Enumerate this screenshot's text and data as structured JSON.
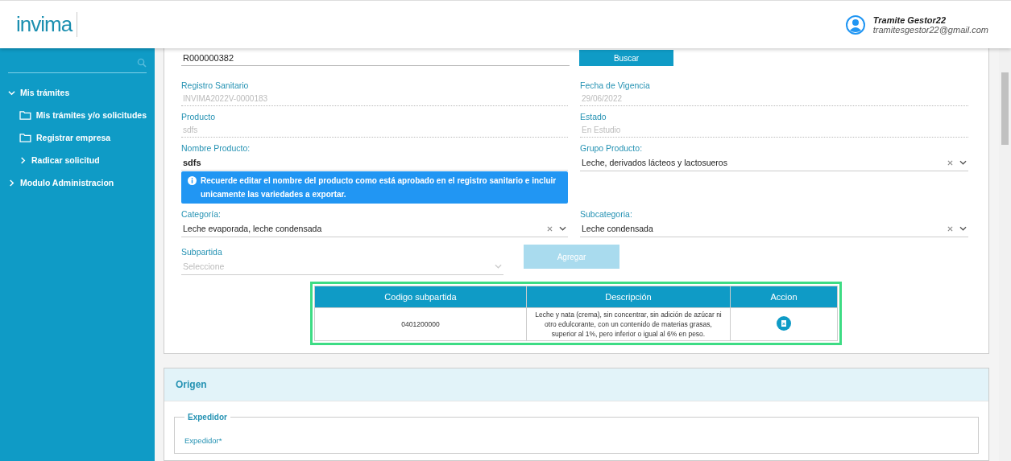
{
  "header": {
    "logo": "invima",
    "user": {
      "name": "Tramite Gestor22",
      "email": "tramitesgestor22@gmail.com"
    }
  },
  "sidebar": {
    "items": [
      {
        "label": "Mis trámites",
        "kind": "group",
        "expanded": true,
        "children": [
          {
            "label": "Mis trámites y/o solicitudes",
            "kind": "folder"
          },
          {
            "label": "Registrar empresa",
            "kind": "folder"
          },
          {
            "label": "Radicar solicitud",
            "kind": "group",
            "expanded": false
          }
        ]
      },
      {
        "label": "Modulo Administracion",
        "kind": "group",
        "expanded": false
      }
    ]
  },
  "search": {
    "value": "R000000382",
    "button": "Buscar"
  },
  "fields": [
    {
      "label": "Registro Sanitario",
      "value": "INVIMA2022V-0000183",
      "kind": "readonly"
    },
    {
      "label": "Fecha de Vigencia",
      "value": "29/06/2022",
      "kind": "readonly"
    },
    {
      "label": "Producto",
      "value": "sdfs",
      "kind": "readonly"
    },
    {
      "label": "Estado",
      "value": "En Estudio",
      "kind": "readonly"
    },
    {
      "label": "Nombre Producto:",
      "value": "sdfs",
      "kind": "input",
      "note": "Recuerde editar el nombre del producto como está aprobado en el registro sanitario e incluir unicamente las variedades a exportar."
    },
    {
      "label": "Grupo Producto:",
      "value": "Leche, derivados lácteos y lactosueros",
      "kind": "select"
    },
    {
      "label": "Categoría:",
      "value": "Leche evaporada, leche condensada",
      "kind": "select"
    },
    {
      "label": "Subcategoria:",
      "value": "Leche condensada",
      "kind": "select"
    }
  ],
  "subpartida": {
    "label": "Subpartida",
    "placeholder": "Seleccione",
    "disabled": true,
    "button": {
      "label": "Agregar",
      "disabled": true
    }
  },
  "table": {
    "highlighted": true,
    "columns": [
      "Codigo subpartida",
      "Descripción",
      "Accion"
    ],
    "rows": [
      {
        "code": "0401200000",
        "description": "Leche y nata (crema), sin concentrar, sin adición de azúcar ni otro edulcorante, con un contenido de materias grasas, superior al 1%, pero inferior o igual al 6% en peso."
      }
    ]
  },
  "origen": {
    "title": "Origen",
    "legend": "Expedidor",
    "field_label": "Expedidor*"
  }
}
